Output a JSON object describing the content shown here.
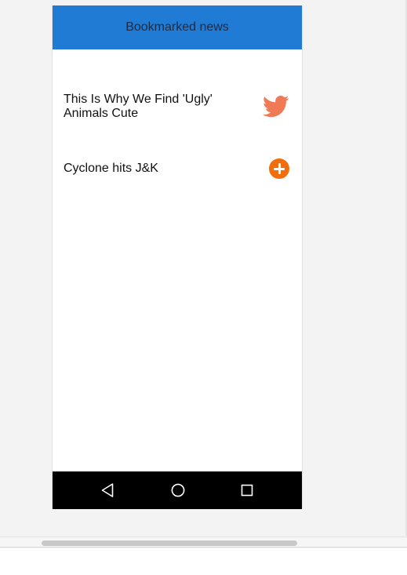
{
  "app_bar": {
    "title": "Bookmarked news"
  },
  "news": [
    {
      "title": "This Is Why We Find 'Ugly' Animals Cute",
      "icon": "twitter-icon",
      "icon_color": "#f07a55"
    },
    {
      "title": "Cyclone hits J&K",
      "icon": "add-circle-icon",
      "icon_color": "#f26e0d"
    }
  ],
  "nav": {
    "back": "back-triangle-icon",
    "home": "home-circle-icon",
    "recents": "recents-square-icon"
  },
  "colors": {
    "app_bar": "#1f7bd3",
    "nav_bar": "#000000",
    "accent_orange": "#f26e0d"
  }
}
